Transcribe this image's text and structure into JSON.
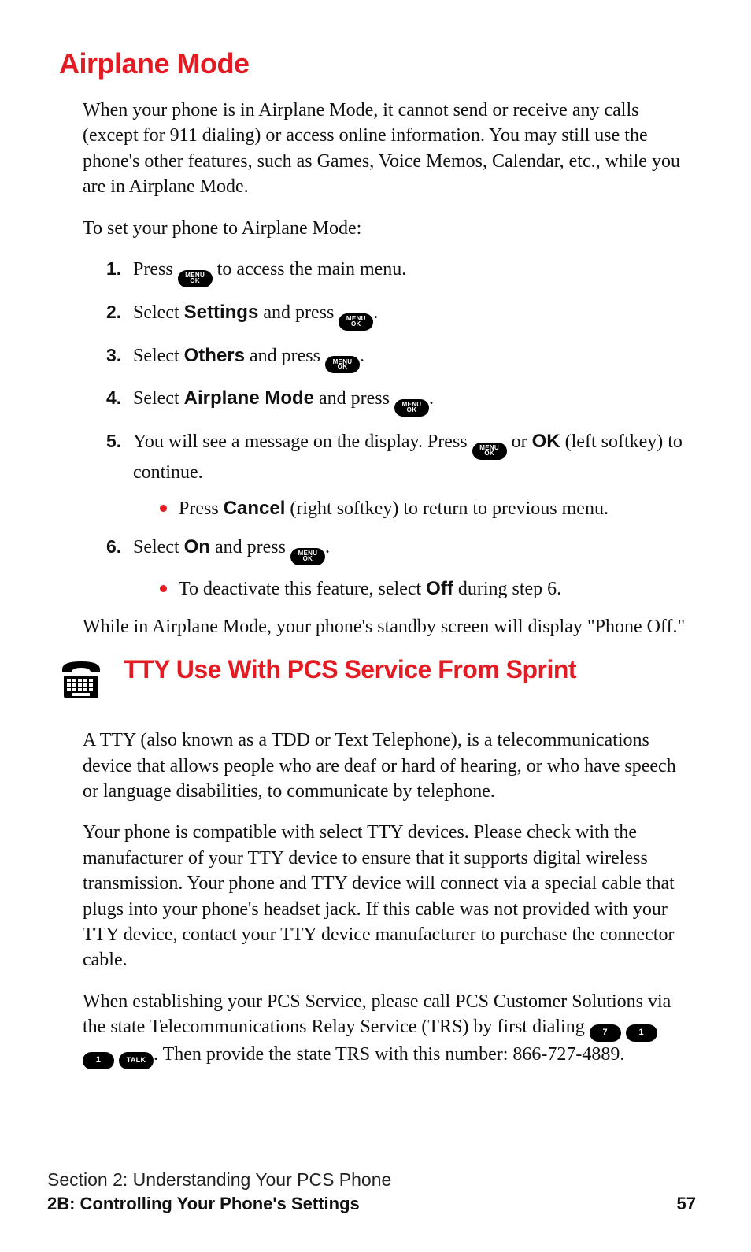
{
  "headings": {
    "airplane": "Airplane Mode",
    "tty": "TTY Use With PCS Service From Sprint"
  },
  "airplane": {
    "intro": "When your phone is in Airplane Mode, it cannot send or receive any calls (except for 911 dialing) or access online information. You may still use the phone's other features, such as Games, Voice Memos, Calendar, etc., while you are in Airplane Mode.",
    "lead": "To set your phone to Airplane Mode:",
    "steps": {
      "s1_pre": "Press ",
      "s1_post": " to access the main menu.",
      "s2_pre": "Select ",
      "s2_bold": "Settings",
      "s2_mid": " and press ",
      "s2_post": ".",
      "s3_pre": "Select ",
      "s3_bold": "Others",
      "s3_mid": " and press ",
      "s3_post": ".",
      "s4_pre": "Select ",
      "s4_bold": "Airplane Mode",
      "s4_mid": " and press ",
      "s4_post": ".",
      "s5_pre": "You will see a message on the display. Press ",
      "s5_mid": " or ",
      "s5_bold": "OK",
      "s5_post": " (left softkey) to continue.",
      "s5_bullet_pre": "Press ",
      "s5_bullet_bold": "Cancel",
      "s5_bullet_post": " (right softkey) to return to previous menu.",
      "s6_pre": "Select ",
      "s6_bold": "On",
      "s6_mid": " and press ",
      "s6_post": ".",
      "s6_bullet_pre": "To deactivate this feature, select ",
      "s6_bullet_bold": "Off",
      "s6_bullet_post": " during step 6."
    },
    "outro": "While in Airplane Mode, your phone's standby screen will display \"Phone Off.\""
  },
  "tty": {
    "p1": "A TTY (also known as a TDD or Text Telephone), is a telecommunications device that allows people who are deaf or hard of hearing, or who have speech or language disabilities, to communicate by telephone.",
    "p2": "Your phone is compatible with select TTY devices. Please check with the manufacturer of your TTY device to ensure that it supports digital wireless transmission. Your phone and TTY device will connect via a special cable that plugs into your phone's headset jack. If this cable was not provided with your TTY device, contact your TTY device manufacturer to purchase the connector cable.",
    "p3_pre": "When establishing your PCS Service, please call PCS Customer Solutions via the state Telecommunications Relay Service (TRS) by first dialing ",
    "p3_post": ". Then provide the state TRS with this number: 866-727-4889."
  },
  "keys": {
    "menu_l1": "MENU",
    "menu_l2": "OK",
    "d7": "7",
    "d1": "1",
    "talk": "TALK"
  },
  "nums": {
    "n1": "1.",
    "n2": "2.",
    "n3": "3.",
    "n4": "4.",
    "n5": "5.",
    "n6": "6."
  },
  "footer": {
    "section": "Section 2: Understanding Your PCS Phone",
    "sub": "2B: Controlling Your Phone's Settings",
    "page": "57"
  }
}
